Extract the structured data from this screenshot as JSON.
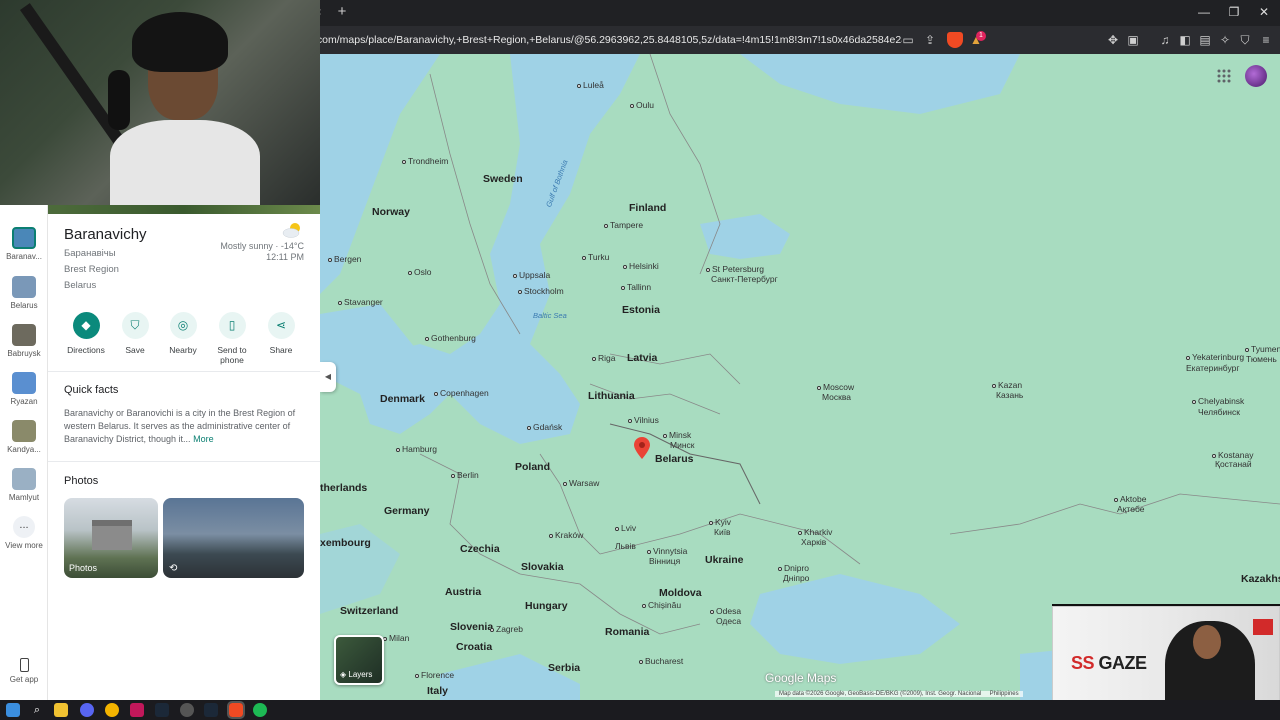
{
  "browser": {
    "url": "gle.com/maps/place/Baranavichy,+Brest+Region,+Belarus/@56.2963962,25.8448105,5z/data=!4m15!1m8!3m7!1s0x46da2584e2ad4881:0xa...",
    "new_tab": "+",
    "tab_close": "×",
    "notification_count": "1"
  },
  "rail": {
    "items": [
      {
        "label": "Baranav...",
        "color": "#4a87b8"
      },
      {
        "label": "Belarus",
        "color": "#7a98b8"
      },
      {
        "label": "Babruysk",
        "color": "#6d6a5e"
      },
      {
        "label": "Ryazan",
        "color": "#5a8fd0"
      },
      {
        "label": "Kandya...",
        "color": "#8a8a6a"
      },
      {
        "label": "Mamlyut",
        "color": "#9ab0c4"
      }
    ],
    "view_more": "View more",
    "more_glyph": "...",
    "get_app": "Get app"
  },
  "place": {
    "name": "Baranavichy",
    "alt_name": "Баранавічы",
    "region": "Brest Region",
    "country": "Belarus",
    "weather": "Mostly sunny · -14°C",
    "time": "12:11 PM"
  },
  "actions": [
    {
      "label": "Directions",
      "icon": "directions-icon"
    },
    {
      "label": "Save",
      "icon": "bookmark-icon"
    },
    {
      "label": "Nearby",
      "icon": "nearby-icon"
    },
    {
      "label": "Send to phone",
      "icon": "phone-icon"
    },
    {
      "label": "Share",
      "icon": "share-icon"
    }
  ],
  "quick_facts": {
    "title": "Quick facts",
    "text": "Baranavichy or Baranovichi is a city in the Brest Region of western Belarus. It serves as the administrative center of Baranavichy District, though it...",
    "more": "More"
  },
  "photos": {
    "title": "Photos",
    "first_label": "Photos"
  },
  "map": {
    "countries": [
      "Sweden",
      "Finland",
      "Norway",
      "Estonia",
      "Latvia",
      "Lithuania",
      "Denmark",
      "Belarus",
      "Poland",
      "Germany",
      "Ukraine",
      "Czechia",
      "Slovakia",
      "Austria",
      "Hungary",
      "Moldova",
      "Romania",
      "Switzerland",
      "Slovenia",
      "Croatia",
      "Serbia",
      "Italy",
      "therlands",
      "xembourg",
      "Kazakhs"
    ],
    "cities": [
      "Luleå",
      "Oulu",
      "Trondheim",
      "Tampere",
      "Bergen",
      "Oslo",
      "Turku",
      "Helsinki",
      "St Petersburg",
      "Санкт-Петербург",
      "Uppsala",
      "Stockholm",
      "Tallinn",
      "Stavanger",
      "Gothenburg",
      "Riga",
      "Tyumen",
      "Тюмень",
      "Yekaterinburg",
      "Екатеринбург",
      "Copenhagen",
      "Moscow",
      "Москва",
      "Kazan",
      "Казань",
      "Chelyabinsk",
      "Челябинск",
      "Vilnius",
      "Gdańsk",
      "Minsk",
      "Минск",
      "Hamburg",
      "Berlin",
      "Warsaw",
      "Kostanay",
      "Қостанай",
      "Kyiv",
      "Київ",
      "Kraków",
      "Lviv",
      "Львів",
      "Kharkiv",
      "Харків",
      "Aktobe",
      "Ақтөбе",
      "Vinnytsia",
      "Вінниця",
      "Dnipro",
      "Дніпро",
      "Chișinău",
      "Odesa",
      "Одеса",
      "Milan",
      "Zagreb",
      "Bucharest",
      "Florence"
    ],
    "seas": [
      "Gulf of Bothnia",
      "Baltic Sea"
    ],
    "layers_label": "Layers",
    "brand": "Google Maps",
    "attribution": "Map data ©2026 Google, GeoBasis-DE/BKG (©2009), Inst. Geogr. Nacional",
    "attribution_extra": "Philippines",
    "water_color": "#9fd2e6",
    "land_color": "#a8dcc0"
  },
  "overlay": {
    "brand_prefix": "SS",
    "brand_suffix": "GAZE"
  }
}
